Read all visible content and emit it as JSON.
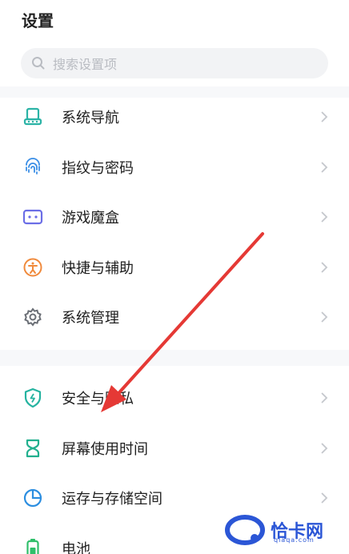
{
  "header": {
    "title": "设置"
  },
  "search": {
    "placeholder": "搜索设置项"
  },
  "group1": [
    {
      "label": "系统导航",
      "icon": "navigation-icon",
      "color": "#2bb3a6"
    },
    {
      "label": "指纹与密码",
      "icon": "fingerprint-icon",
      "color": "#3a8ee6"
    },
    {
      "label": "游戏魔盒",
      "icon": "gamebox-icon",
      "color": "#6b6ee6"
    },
    {
      "label": "快捷与辅助",
      "icon": "accessibility-icon",
      "color": "#f08a3c"
    },
    {
      "label": "系统管理",
      "icon": "gear-icon",
      "color": "#6b6f76"
    }
  ],
  "group2": [
    {
      "label": "安全与隐私",
      "icon": "shield-icon",
      "color": "#25b3a0"
    },
    {
      "label": "屏幕使用时间",
      "icon": "hourglass-icon",
      "color": "#21b08e"
    },
    {
      "label": "运存与存储空间",
      "icon": "pie-chart-icon",
      "color": "#2c8ee0"
    },
    {
      "label": "电池",
      "icon": "battery-icon",
      "color": "#2fbf6a"
    }
  ],
  "watermark": {
    "text": "恰卡网",
    "sub": "qiaqa.com",
    "color": "#2b56d6"
  },
  "annotation": {
    "arrow_color": "#e53935"
  }
}
